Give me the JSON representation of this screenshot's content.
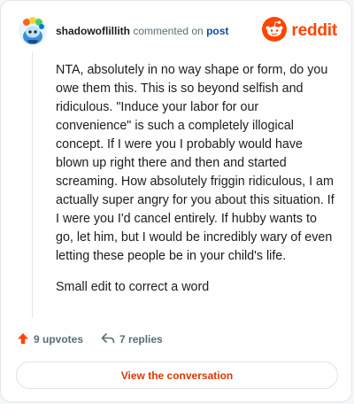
{
  "header": {
    "username": "shadowoflillith",
    "action_text": "commented on",
    "post_link": "post",
    "logo_text": "reddit"
  },
  "comment": {
    "paragraphs": [
      "NTA, absolutely in no way shape or form, do you owe them this. This is so beyond selfish and ridiculous. \"Induce your labor for our convenience\" is such a completely illogical concept. If I were you I probably would have blown up right there and then and started screaming. How absolutely friggin ridiculous, I am actually super angry for you about this situation. If I were you I'd cancel entirely. If hubby wants to go, let him, but I would be incredibly wary of even letting these people be in your child's life.",
      "Small edit to correct a word"
    ]
  },
  "actions": {
    "upvotes_label": "9 upvotes",
    "replies_label": "7 replies"
  },
  "cta": {
    "label": "View the conversation"
  },
  "icons": {
    "avatar": "snoo-avatar-icon",
    "logo": "reddit-logo-icon",
    "upvote": "upvote-arrow-icon",
    "reply": "reply-arrow-icon"
  },
  "colors": {
    "brand": "#ff4500",
    "link": "#0f4aa3",
    "cta_text": "#d93a00",
    "muted": "#576f76"
  }
}
